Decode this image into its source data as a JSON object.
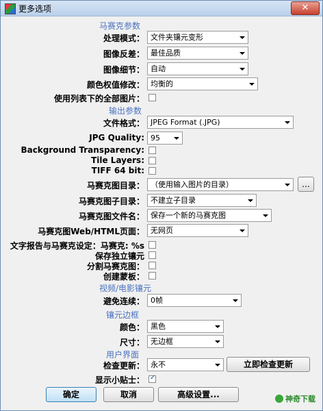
{
  "window": {
    "title": "更多选项",
    "close_glyph": "✕"
  },
  "sections": {
    "mosaic": "马赛克参数",
    "output": "输出参数",
    "video": "视频/电影镶元",
    "border": "镶元边框",
    "ui": "用户界面"
  },
  "mosaic": {
    "process_mode": {
      "label": "处理模式：",
      "value": "文件夹镶元变形"
    },
    "invert": {
      "label": "图像反差：",
      "value": "最佳品质"
    },
    "detail": {
      "label": "图像细节：",
      "value": "自动"
    },
    "color_weight": {
      "label": "颜色权值修改：",
      "value": "均衡的"
    },
    "use_list": {
      "label": "使用列表下的全部图片：",
      "checked": false
    }
  },
  "output": {
    "format": {
      "label": "文件格式：",
      "value": "JPEG Format (.JPG)"
    },
    "jpg_quality": {
      "label": "JPG Quality:",
      "value": "95"
    },
    "bg_transparency": {
      "label": "Background Transparency:",
      "checked": false
    },
    "tile_layers": {
      "label": "Tile Layers:",
      "checked": false
    },
    "tiff64": {
      "label": "TIFF 64 bit:",
      "checked": false
    },
    "mosaic_dir": {
      "label": "马赛克图目录：",
      "value": "（使用输入图片的目录）",
      "browse": "..."
    },
    "sub_dir": {
      "label": "马赛克图子目录：",
      "value": "不建立子目录"
    },
    "file_name": {
      "label": "马赛克图文件名：",
      "value": "保存一个新的马赛克图"
    },
    "web_page": {
      "label": "马赛克图Web/HTML页面：",
      "value": "无网页"
    },
    "text_report": {
      "label": "文字报告与马赛克设定：马赛克: %s",
      "checked": false
    },
    "save_tiles": {
      "label": "保存独立镶元",
      "checked": false
    },
    "split": {
      "label": "分割马赛克图：",
      "checked": false
    },
    "create_mask": {
      "label": "创建蒙板：",
      "checked": false
    }
  },
  "video": {
    "avoid_consecutive": {
      "label": "避免连续：",
      "value": "0帧"
    }
  },
  "border": {
    "color": {
      "label": "颜色：",
      "value": "黑色"
    },
    "size": {
      "label": "尺寸：",
      "value": "无边框"
    }
  },
  "ui": {
    "check_update": {
      "label": "检查更新：",
      "value": "永不",
      "button": "立即检查更新"
    },
    "show_tips": {
      "label": "显示小贴士：",
      "checked": true
    }
  },
  "footer": {
    "ok": "确定",
    "cancel": "取消",
    "advanced": "高级设置...",
    "watermark": "神奇下载"
  }
}
